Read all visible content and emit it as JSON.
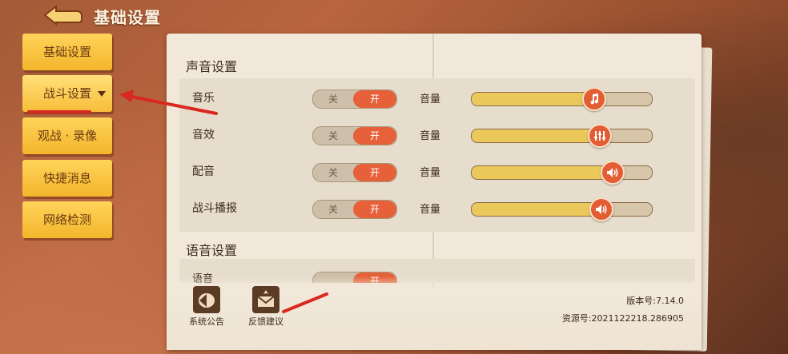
{
  "header": {
    "title": "基础设置",
    "back": "back-arrow-icon"
  },
  "side_menu": {
    "items": [
      {
        "label": "基础设置",
        "active": false
      },
      {
        "label": "战斗设置",
        "active": true
      },
      {
        "label": "观战 · 录像",
        "active": false
      },
      {
        "label": "快捷消息",
        "active": false
      },
      {
        "label": "网络检测",
        "active": false
      }
    ]
  },
  "sound_section": {
    "title": "声音设置",
    "rows": [
      {
        "label": "音乐",
        "off": "关",
        "on": "开",
        "volume_label": "音量",
        "volume": 0.68,
        "icon": "music-note-icon"
      },
      {
        "label": "音效",
        "off": "关",
        "on": "开",
        "volume_label": "音量",
        "volume": 0.71,
        "icon": "equalizer-icon"
      },
      {
        "label": "配音",
        "off": "关",
        "on": "开",
        "volume_label": "音量",
        "volume": 0.78,
        "icon": "speaker-icon"
      },
      {
        "label": "战斗播报",
        "off": "关",
        "on": "开",
        "volume_label": "音量",
        "volume": 0.72,
        "icon": "speaker-icon"
      }
    ]
  },
  "voice_section": {
    "title": "语音设置",
    "partial_label": "语音",
    "partial_on": "开"
  },
  "bottom": {
    "shortcuts": [
      {
        "label": "系统公告",
        "icon": "announcement-icon"
      },
      {
        "label": "反馈建议",
        "icon": "feedback-mail-icon"
      }
    ],
    "version": "版本号:7.14.0",
    "resource": "资源号:2021122218.286905"
  },
  "colors": {
    "accent": "#e6613a",
    "button": "#f4b52b",
    "slider_fill": "#ebc85a",
    "annotation": "#d8281f"
  }
}
